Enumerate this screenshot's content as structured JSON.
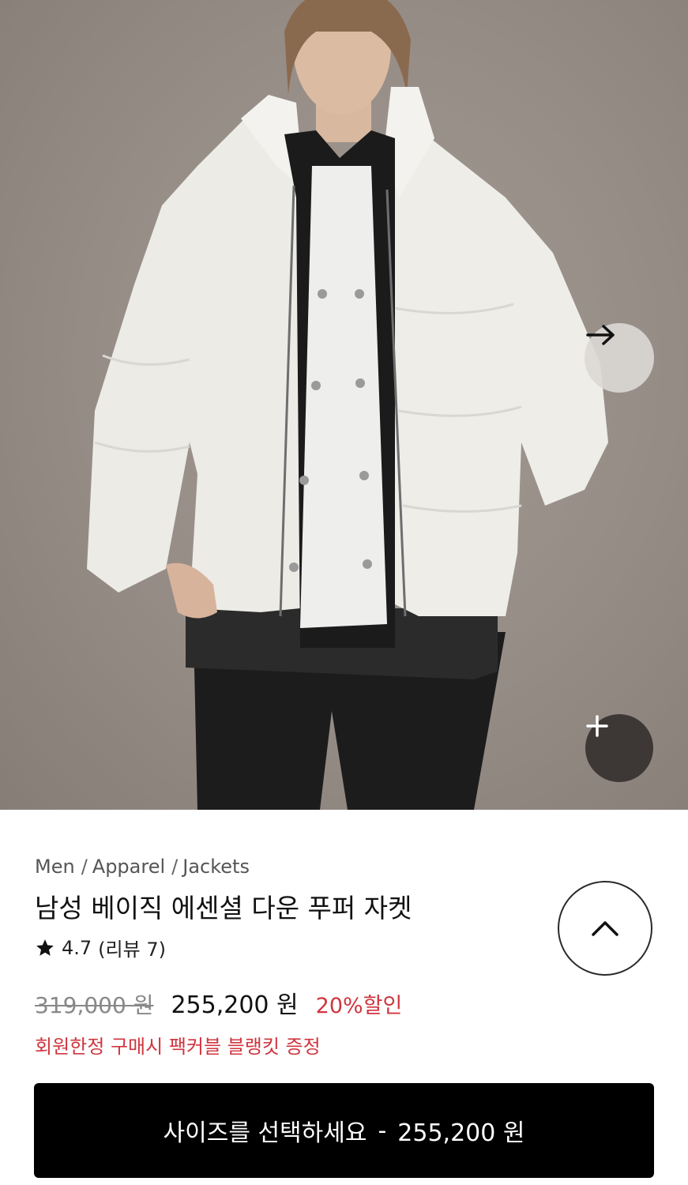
{
  "gallery": {
    "image_alt": "Model wearing white down puffer jacket",
    "next_icon": "arrow-right-icon",
    "zoom_icon": "plus-icon"
  },
  "breadcrumb": [
    "Men",
    "Apparel",
    "Jackets"
  ],
  "breadcrumb_separator": "/",
  "product": {
    "name": "남성 베이직 에센셜 다운 푸퍼 자켓",
    "rating": "4.7",
    "reviews": "(리뷰 7)",
    "original_price": "319,000 원",
    "sale_price": "255,200 원",
    "discount": "20%할인",
    "promo": "회원한정 구매시 팩커블 블랭킷 증정"
  },
  "cta": {
    "label": "사이즈를 선택하세요",
    "separator": "-",
    "price": "255,200 원"
  },
  "colors": {
    "accent_red": "#d0353f",
    "cta_bg": "#000000"
  }
}
